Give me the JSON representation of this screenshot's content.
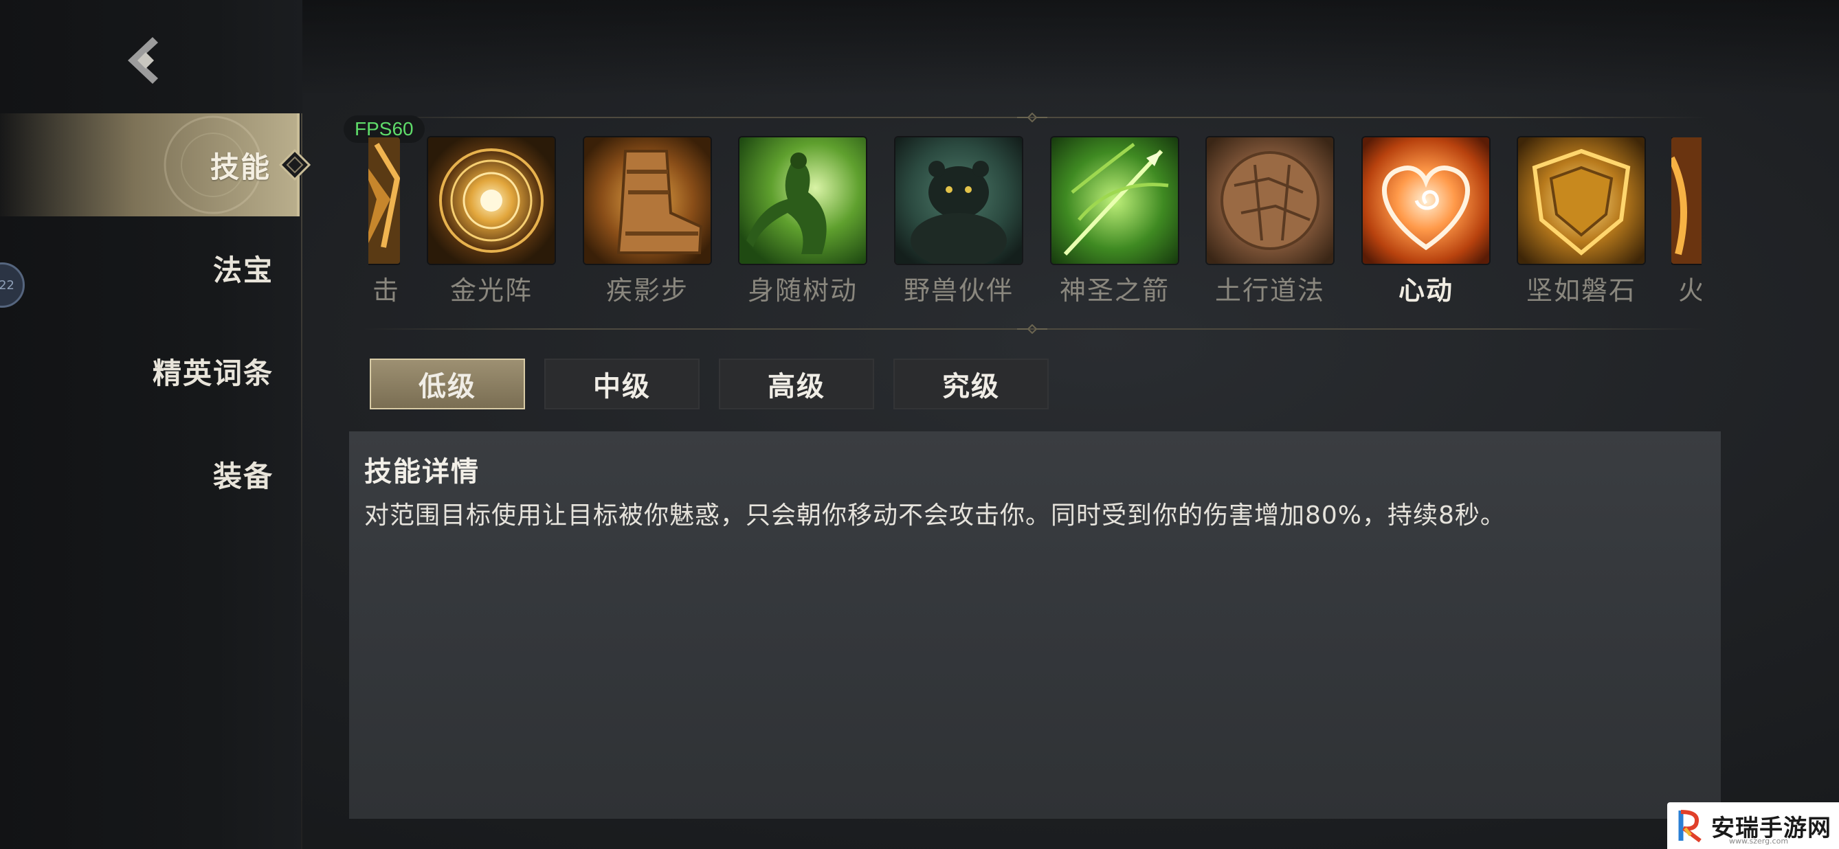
{
  "sidebar": {
    "items": [
      {
        "label": "技能",
        "active": true
      },
      {
        "label": "法宝",
        "active": false
      },
      {
        "label": "精英词条",
        "active": false
      },
      {
        "label": "装备",
        "active": false
      }
    ],
    "circle_badge": "22"
  },
  "fps": "FPS60",
  "skills": {
    "partial_left": "击",
    "items": [
      {
        "name": "金光阵",
        "icon": "golden-light-array-icon"
      },
      {
        "name": "疾影步",
        "icon": "swift-shadow-boot-icon"
      },
      {
        "name": "身随树动",
        "icon": "tree-movement-icon"
      },
      {
        "name": "野兽伙伴",
        "icon": "beast-companion-icon"
      },
      {
        "name": "神圣之箭",
        "icon": "holy-arrow-icon"
      },
      {
        "name": "土行道法",
        "icon": "earth-taoism-icon"
      },
      {
        "name": "心动",
        "icon": "heart-charm-icon",
        "selected": true
      },
      {
        "name": "坚如磐石",
        "icon": "rock-shield-icon"
      }
    ],
    "partial_right": "火"
  },
  "tiers": [
    {
      "label": "低级",
      "active": true
    },
    {
      "label": "中级",
      "active": false
    },
    {
      "label": "高级",
      "active": false
    },
    {
      "label": "究级",
      "active": false
    }
  ],
  "detail": {
    "title": "技能详情",
    "text": "对范围目标使用让目标被你魅惑，只会朝你移动不会攻击你。同时受到你的伤害增加80%，持续8秒。"
  },
  "watermark": {
    "text": "安瑞手游网",
    "sub": "www.szerg.com"
  }
}
